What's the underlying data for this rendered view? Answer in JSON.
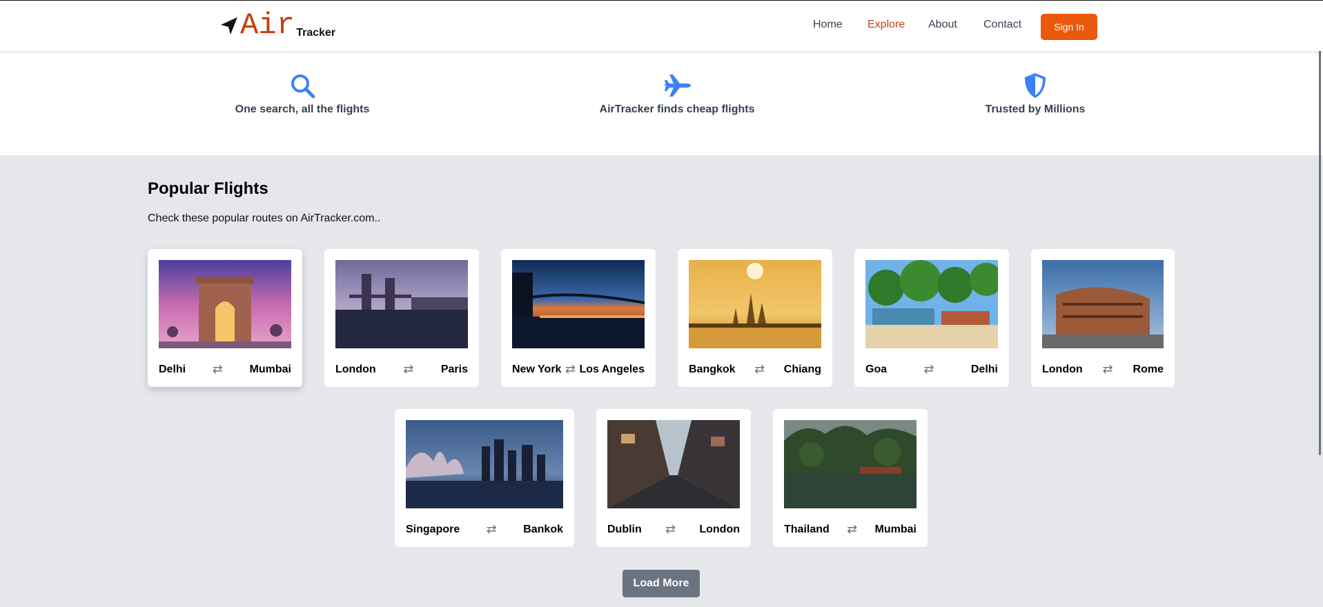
{
  "header": {
    "logo_air": "Air",
    "logo_tracker": "Tracker",
    "nav": [
      {
        "label": "Home",
        "active": false
      },
      {
        "label": "Explore",
        "active": true
      },
      {
        "label": "About",
        "active": false
      },
      {
        "label": "Contact",
        "active": false
      }
    ],
    "signin_label": "Sign In"
  },
  "features": [
    {
      "icon": "search-icon",
      "label": "One search, all the flights"
    },
    {
      "icon": "airplane-icon",
      "label": "AirTracker finds cheap flights"
    },
    {
      "icon": "shield-icon",
      "label": "Trusted by Millions"
    }
  ],
  "popular": {
    "title": "Popular Flights",
    "subtitle": "Check these popular routes on AirTracker.com..",
    "routes": [
      {
        "from": "Delhi",
        "to": "Mumbai",
        "image": "india-gate-photo"
      },
      {
        "from": "London",
        "to": "Paris",
        "image": "tower-bridge-photo"
      },
      {
        "from": "New York",
        "to": "Los Angeles",
        "image": "williamsburg-bridge-photo"
      },
      {
        "from": "Bangkok",
        "to": "Chiang",
        "image": "wat-arun-photo"
      },
      {
        "from": "Goa",
        "to": "Delhi",
        "image": "palm-beach-photo"
      },
      {
        "from": "London",
        "to": "Rome",
        "image": "colosseum-photo"
      },
      {
        "from": "Singapore",
        "to": "Bankok",
        "image": "marina-bay-photo"
      },
      {
        "from": "Dublin",
        "to": "London",
        "image": "city-street-photo"
      },
      {
        "from": "Thailand",
        "to": "Mumbai",
        "image": "jungle-lake-photo"
      }
    ],
    "swap_icon": "swap-arrows-icon",
    "load_more_label": "Load More"
  },
  "colors": {
    "accent": "#ea580c",
    "accent_text": "#c2410c",
    "icon_blue": "#3b82f6",
    "section_bg": "#e5e7eb",
    "button_gray": "#6b7280"
  }
}
